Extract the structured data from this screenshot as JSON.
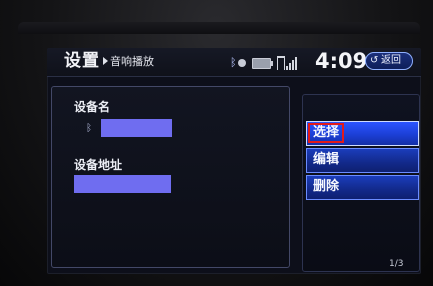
{
  "header": {
    "title": "设置",
    "breadcrumb": "音响播放",
    "clock": "4:09",
    "back_label": "返回"
  },
  "info": {
    "device_name_label": "设备名",
    "device_address_label": "设备地址",
    "device_name_value": "",
    "device_address_value": ""
  },
  "menu": {
    "items": [
      {
        "label": "选择",
        "selected": true
      },
      {
        "label": "编辑",
        "selected": false
      },
      {
        "label": "删除",
        "selected": false
      }
    ]
  },
  "pagination": {
    "indicator": "1/3"
  },
  "colors": {
    "accent_blue": "#1c3fd6",
    "highlight_red": "#e21a1a",
    "redacted_bar": "#6f6df0"
  }
}
